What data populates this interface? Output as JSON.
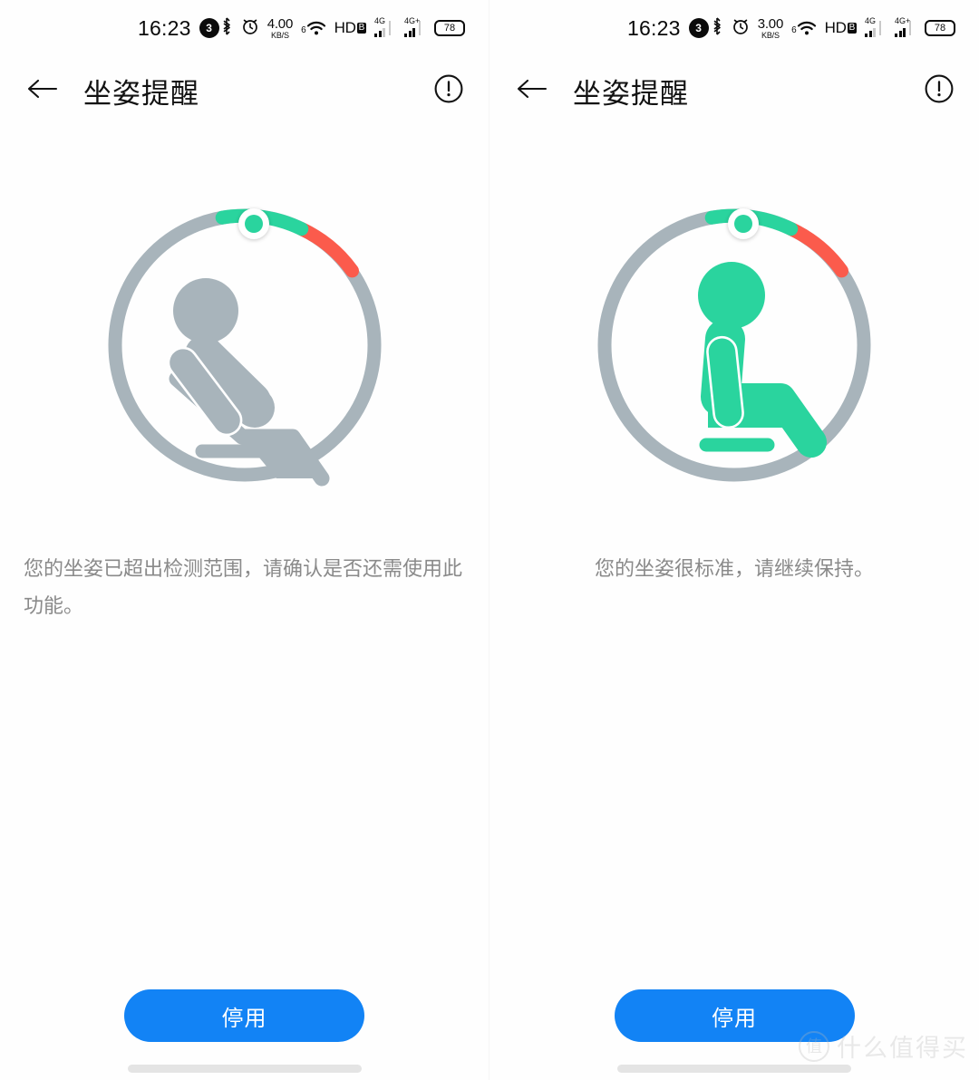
{
  "colors": {
    "accent_blue": "#1283f5",
    "gauge_track": "#a8b4bb",
    "gauge_green": "#2ad49e",
    "gauge_red": "#fb5b4c",
    "figure_gray": "#a8b4bb",
    "figure_green": "#2ad49e",
    "text_primary": "#121212",
    "text_muted": "#8a8a8a"
  },
  "panels": [
    {
      "id": "left",
      "status_bar": {
        "time": "16:23",
        "notification_count": "3",
        "bluetooth_icon": "bluetooth-icon",
        "alarm_icon": "alarm-clock-icon",
        "net_speed_value": "4.00",
        "net_speed_unit": "KB/S",
        "wifi_icon": "wifi-6-icon",
        "wifi_generation": "6",
        "hd_label": "HD",
        "hd_badge": "B",
        "sim1_label": "4G",
        "sim2_label": "4G+",
        "battery_level": "78"
      },
      "app_bar": {
        "back_icon": "back-arrow-icon",
        "title": "坐姿提醒",
        "info_icon": "info-exclamation-icon"
      },
      "gauge": {
        "track_start_deg": -10,
        "green_start_deg": -10,
        "green_end_deg": 26,
        "red_start_deg": 26,
        "red_end_deg": 56,
        "marker_angle_deg": -10,
        "marker_fill": "#2ad49e"
      },
      "figure": {
        "name": "posture-figure-slouching",
        "color": "#a8b4bb",
        "posture": "slouched"
      },
      "message": "您的坐姿已超出检测范围，请确认是否还需使用此功能。",
      "message_align": "left",
      "button_label": "停用"
    },
    {
      "id": "right",
      "status_bar": {
        "time": "16:23",
        "notification_count": "3",
        "bluetooth_icon": "bluetooth-icon",
        "alarm_icon": "alarm-clock-icon",
        "net_speed_value": "3.00",
        "net_speed_unit": "KB/S",
        "wifi_icon": "wifi-6-icon",
        "wifi_generation": "6",
        "hd_label": "HD",
        "hd_badge": "B",
        "sim1_label": "4G",
        "sim2_label": "4G+",
        "battery_level": "78"
      },
      "app_bar": {
        "back_icon": "back-arrow-icon",
        "title": "坐姿提醒",
        "info_icon": "info-exclamation-icon"
      },
      "gauge": {
        "track_start_deg": -10,
        "green_start_deg": -10,
        "green_end_deg": 26,
        "red_start_deg": 26,
        "red_end_deg": 56,
        "marker_angle_deg": -10,
        "marker_fill": "#2ad49e"
      },
      "figure": {
        "name": "posture-figure-upright",
        "color": "#2ad49e",
        "posture": "upright"
      },
      "message": "您的坐姿很标准，请继续保持。",
      "message_align": "center",
      "button_label": "停用"
    }
  ],
  "watermark": {
    "logo_glyph": "值",
    "text": "什么值得买"
  }
}
